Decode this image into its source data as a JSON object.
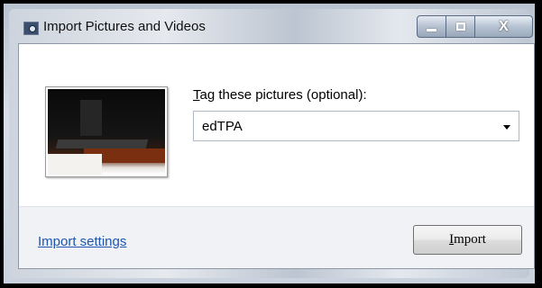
{
  "window": {
    "title": "Import Pictures and Videos",
    "icon": "camera-icon"
  },
  "caption_buttons": {
    "minimize": "minimize-icon",
    "maximize": "maximize-icon",
    "close_glyph": "X"
  },
  "tag": {
    "label_accel": "T",
    "label_rest": "ag these pictures (optional):",
    "value": "edTPA",
    "dropdown_icon": "chevron-down-icon"
  },
  "footer": {
    "settings_link": "Import settings",
    "import_accel": "I",
    "import_rest": "mport"
  },
  "colors": {
    "link": "#1c56b0",
    "text": "#000000"
  }
}
